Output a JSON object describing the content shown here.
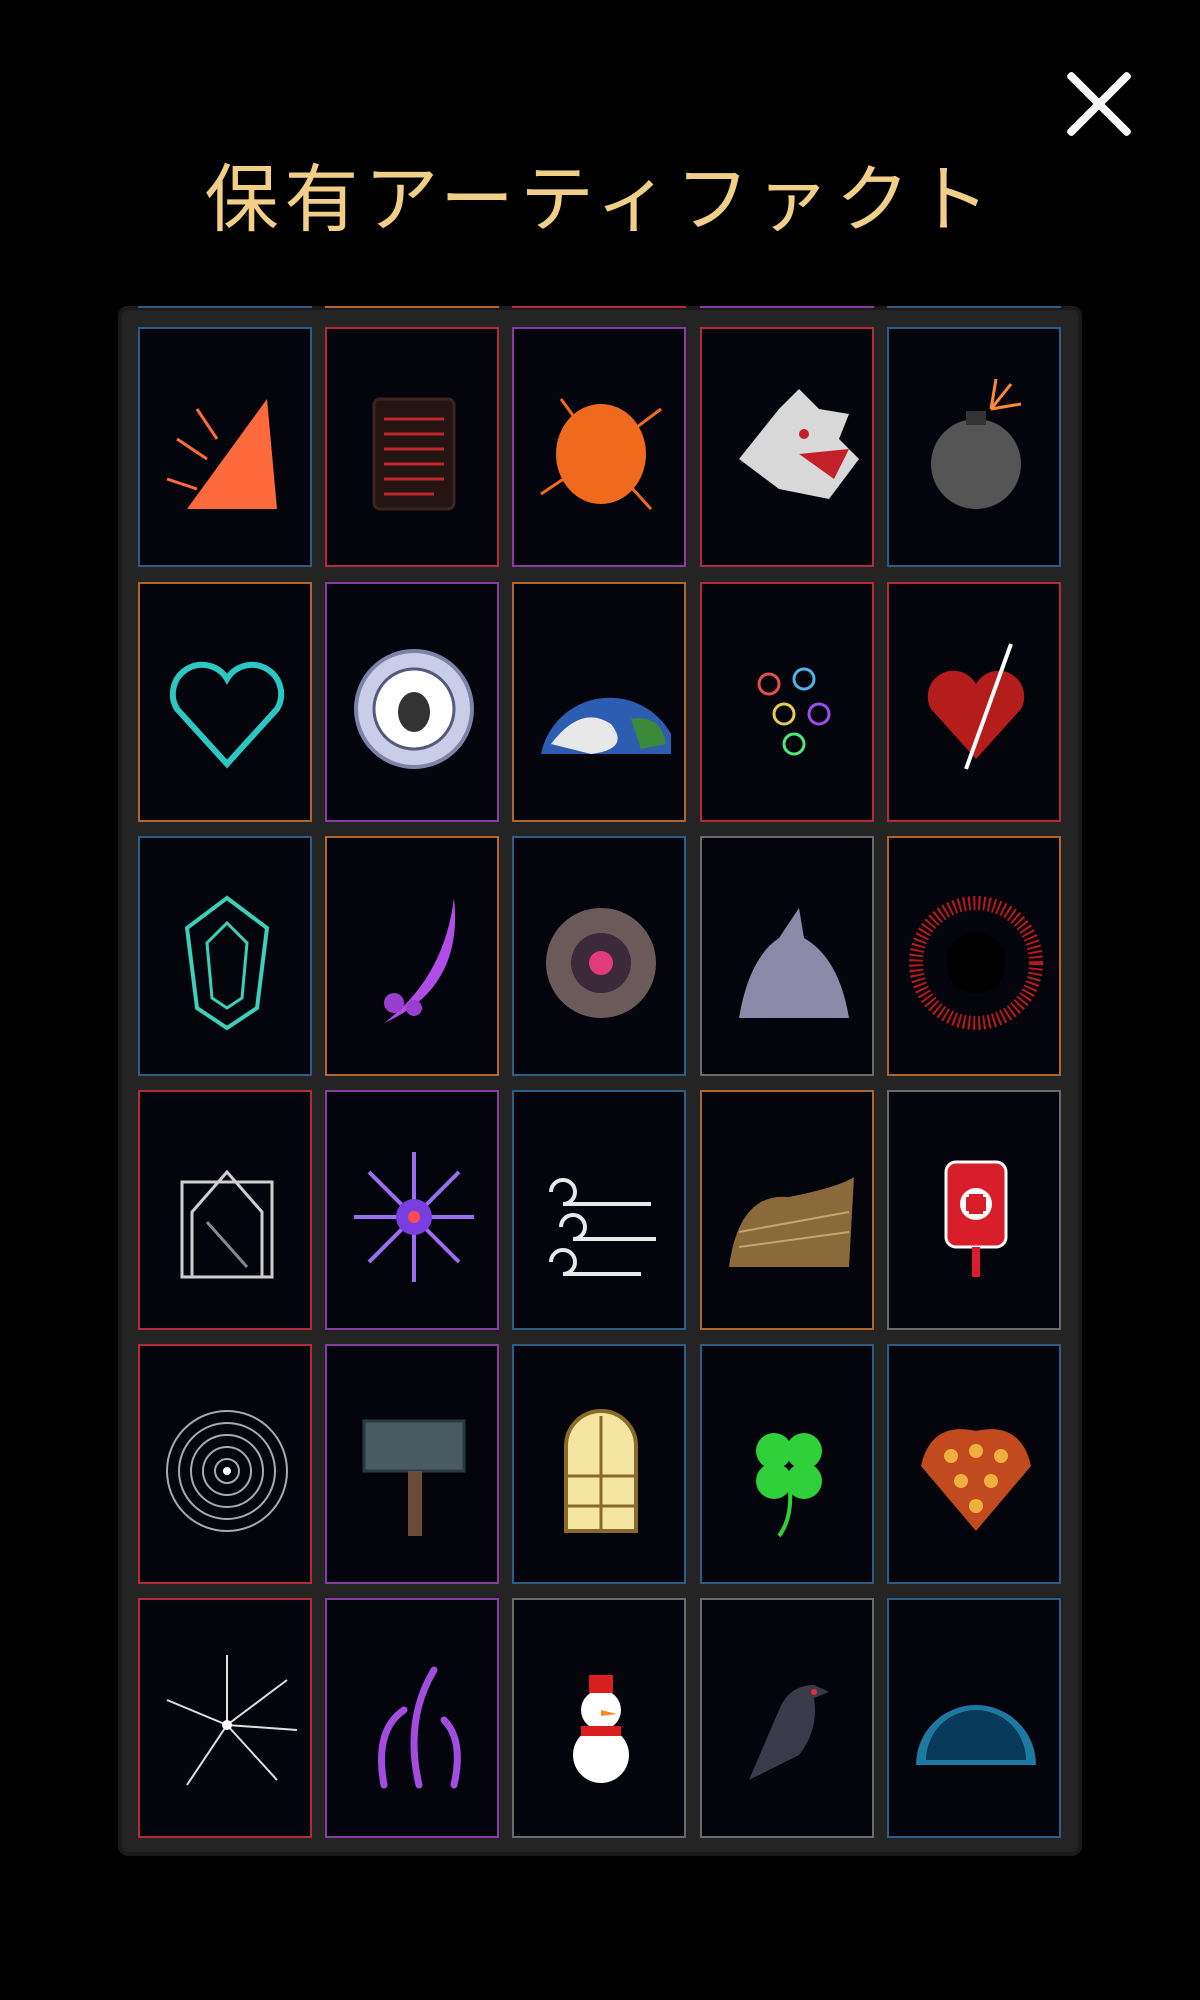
{
  "header": {
    "title": "保有アーティファクト",
    "close_icon": "close-icon"
  },
  "colors": {
    "title": "#f2cf86",
    "frame": "#242424",
    "card_bg": "#04050c"
  },
  "artifacts": [
    {
      "icon": "shard-spike-icon",
      "border": "#2b5e86"
    },
    {
      "icon": "stone-tablet-icon",
      "border": "#b42a3c"
    },
    {
      "icon": "orange-spike-burst-icon",
      "border": "#8a3aa0"
    },
    {
      "icon": "wolf-head-icon",
      "border": "#b42a3c"
    },
    {
      "icon": "bomb-icon",
      "border": "#2b5e86"
    },
    {
      "icon": "teal-heart-icon",
      "border": "#b0662a"
    },
    {
      "icon": "sun-face-medallion-icon",
      "border": "#8a3aa0"
    },
    {
      "icon": "earth-globe-icon",
      "border": "#b0662a"
    },
    {
      "icon": "colored-rings-icon",
      "border": "#b42a3c"
    },
    {
      "icon": "pierced-heart-icon",
      "border": "#b42a3c"
    },
    {
      "icon": "crystal-gem-icon",
      "border": "#2b5e86"
    },
    {
      "icon": "purple-scythe-icon",
      "border": "#b0662a"
    },
    {
      "icon": "dark-vortex-icon",
      "border": "#2b5e86"
    },
    {
      "icon": "grey-beast-icon",
      "border": "#6a6a6a"
    },
    {
      "icon": "red-eclipse-icon",
      "border": "#b0662a"
    },
    {
      "icon": "ruined-cathedral-icon",
      "border": "#b42a3c"
    },
    {
      "icon": "purple-urchin-icon",
      "border": "#8a3aa0"
    },
    {
      "icon": "wind-swirls-icon",
      "border": "#2b5e86"
    },
    {
      "icon": "hay-pile-icon",
      "border": "#b0662a"
    },
    {
      "icon": "blood-bag-icon",
      "border": "#6a6a6a"
    },
    {
      "icon": "ripple-rings-icon",
      "border": "#b42a3c"
    },
    {
      "icon": "war-hammer-icon",
      "border": "#8a3aa0"
    },
    {
      "icon": "stained-window-icon",
      "border": "#2b5e86"
    },
    {
      "icon": "four-leaf-clover-icon",
      "border": "#2b5e86"
    },
    {
      "icon": "flame-scales-icon",
      "border": "#2b5e86"
    },
    {
      "icon": "shatter-burst-icon",
      "border": "#b42a3c"
    },
    {
      "icon": "purple-tentacles-icon",
      "border": "#8a3aa0"
    },
    {
      "icon": "snowman-icon",
      "border": "#6a6a6a"
    },
    {
      "icon": "crow-icon",
      "border": "#6a6a6a"
    },
    {
      "icon": "blue-orb-icon",
      "border": "#2b5e86"
    }
  ]
}
